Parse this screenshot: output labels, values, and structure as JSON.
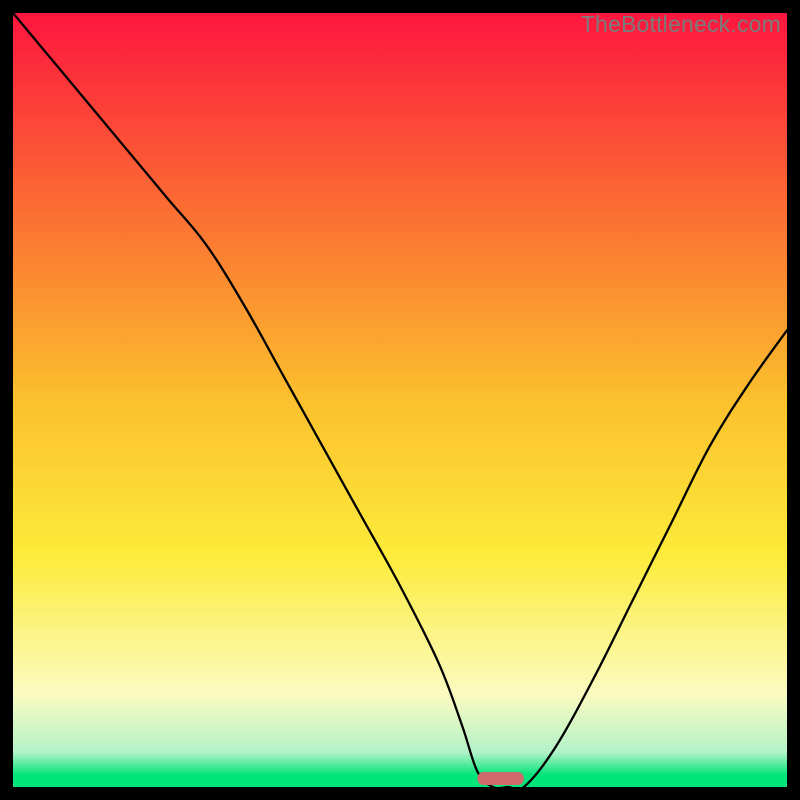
{
  "watermark": "TheBottleneck.com",
  "chart_data": {
    "type": "line",
    "title": "",
    "xlabel": "",
    "ylabel": "",
    "xlim": [
      0,
      100
    ],
    "ylim": [
      0,
      100
    ],
    "background_gradient": {
      "stops": [
        {
          "pos": 0.0,
          "color": "#fd163e"
        },
        {
          "pos": 0.25,
          "color": "#fb6c33"
        },
        {
          "pos": 0.5,
          "color": "#fbc02d"
        },
        {
          "pos": 0.7,
          "color": "#fdeb3a"
        },
        {
          "pos": 0.88,
          "color": "#fbfbc0"
        },
        {
          "pos": 0.955,
          "color": "#b3f2c8"
        },
        {
          "pos": 0.985,
          "color": "#00e579"
        },
        {
          "pos": 1.0,
          "color": "#00e579"
        }
      ]
    },
    "series": [
      {
        "name": "bottleneck-curve",
        "x": [
          0,
          5,
          10,
          15,
          20,
          25,
          30,
          35,
          40,
          45,
          50,
          55,
          58,
          60,
          62,
          64,
          66,
          70,
          75,
          80,
          85,
          90,
          95,
          100
        ],
        "y": [
          100,
          94,
          88,
          82,
          76,
          70,
          62,
          53,
          44,
          35,
          26,
          16,
          8,
          2,
          0,
          0,
          0,
          5,
          14,
          24,
          34,
          44,
          52,
          59
        ]
      }
    ],
    "marker": {
      "name": "optimal-zone",
      "x_start": 60,
      "x_end": 66,
      "color": "#cf6a6d"
    }
  }
}
